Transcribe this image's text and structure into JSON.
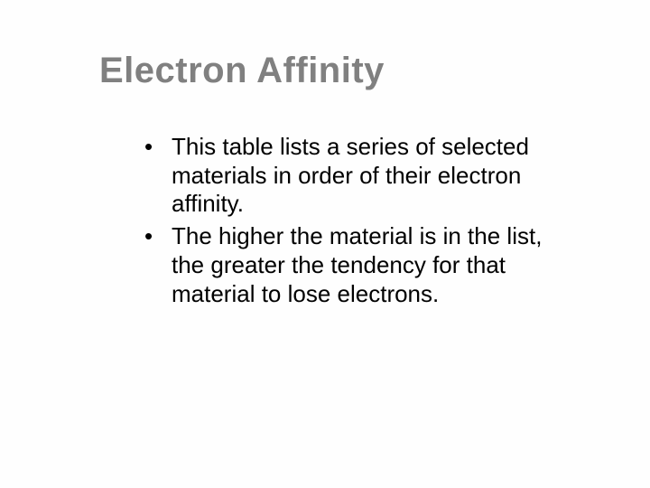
{
  "slide": {
    "title": "Electron Affinity",
    "bullets": [
      "This table lists a series of selected materials in order of their electron affinity.",
      "The higher the material is in the list, the greater the tendency for that material to lose electrons."
    ]
  }
}
